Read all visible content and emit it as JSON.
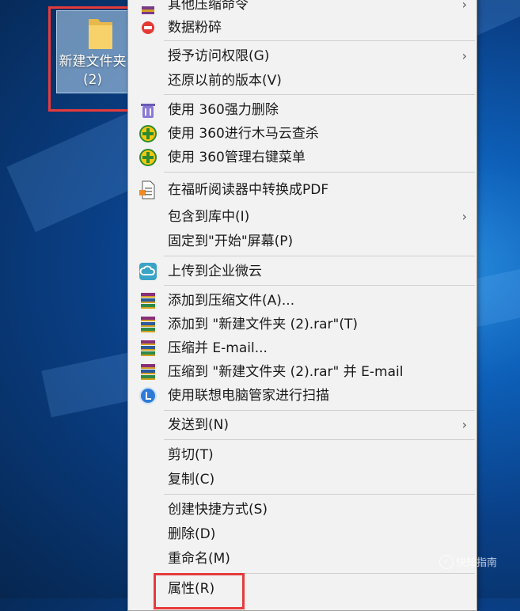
{
  "desktop": {
    "folder_label": "新建文件夹\n(2)"
  },
  "menu": {
    "top_partial": "其他压缩命令",
    "items": [
      {
        "label": "数据粉碎"
      },
      {
        "label": "授予访问权限(G)"
      },
      {
        "label": "还原以前的版本(V)"
      },
      {
        "label": "使用 360强力删除"
      },
      {
        "label": "使用 360进行木马云查杀"
      },
      {
        "label": "使用 360管理右键菜单"
      },
      {
        "label": "在福昕阅读器中转换成PDF"
      },
      {
        "label": "包含到库中(I)"
      },
      {
        "label": "固定到\"开始\"屏幕(P)"
      },
      {
        "label": "上传到企业微云"
      },
      {
        "label": "添加到压缩文件(A)..."
      },
      {
        "label": "添加到 \"新建文件夹 (2).rar\"(T)"
      },
      {
        "label": "压缩并 E-mail..."
      },
      {
        "label": "压缩到 \"新建文件夹 (2).rar\" 并 E-mail"
      },
      {
        "label": "使用联想电脑管家进行扫描"
      },
      {
        "label": "发送到(N)"
      },
      {
        "label": "剪切(T)"
      },
      {
        "label": "复制(C)"
      },
      {
        "label": "创建快捷方式(S)"
      },
      {
        "label": "删除(D)"
      },
      {
        "label": "重命名(M)"
      },
      {
        "label": "属性(R)"
      }
    ]
  },
  "watermark": {
    "text": "快知指南"
  },
  "colors": {
    "highlight_box": "#e53b3b",
    "menu_bg": "#f2f2f2"
  }
}
